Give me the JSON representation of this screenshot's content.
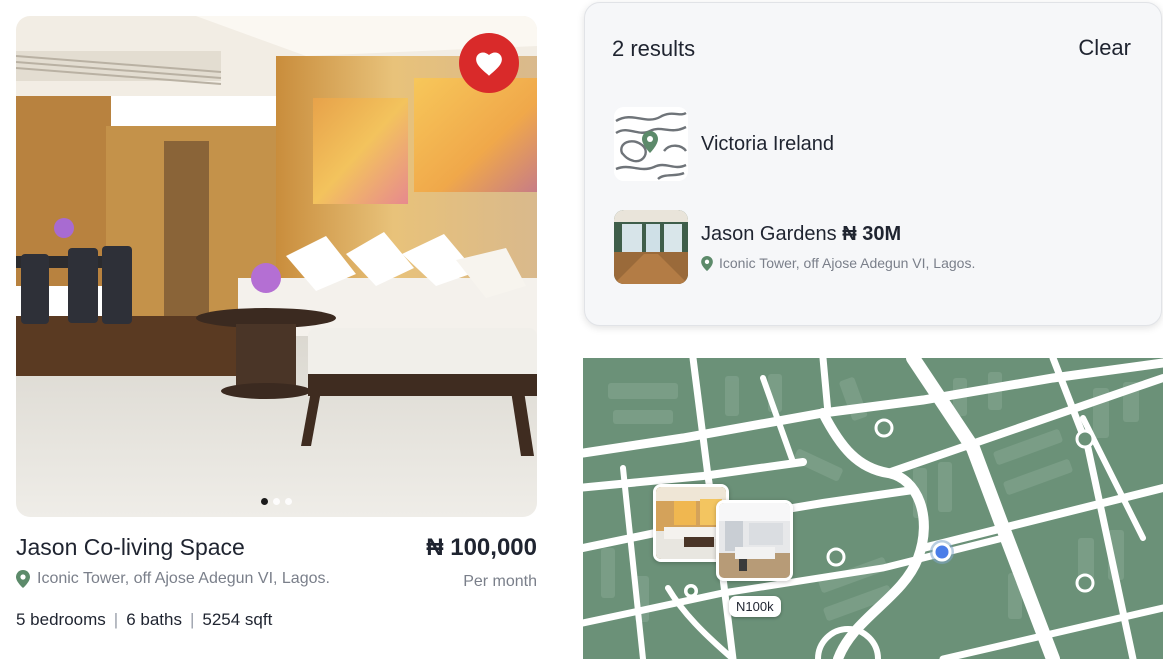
{
  "listing": {
    "title": "Jason Co-living Space",
    "price": "₦ 100,000",
    "period": "Per month",
    "address": "Iconic Tower, off Ajose Adegun VI, Lagos.",
    "bedrooms": "5 bedrooms",
    "baths": "6 baths",
    "area": "5254 sqft",
    "separator": "|",
    "carousel": {
      "slides": 3,
      "active_index": 0
    },
    "favorite_icon": "heart-icon",
    "favorited": true
  },
  "results": {
    "count_label": "2 results",
    "clear_label": "Clear",
    "items": [
      {
        "title": "Victoria Ireland",
        "icon": "map-pin-icon"
      },
      {
        "title": "Jason Gardens",
        "price": "₦ 30M",
        "address": "Iconic Tower, off Ajose Adegun VI, Lagos.",
        "icon": "location-pin-icon"
      }
    ]
  },
  "map": {
    "price_tag": "N100k"
  },
  "colors": {
    "favorite": "#d92a2a",
    "map_fill": "#6b9178",
    "pin_green": "#5c8a6a",
    "selected_marker": "#4a7de8",
    "text_primary": "#1f2430",
    "text_secondary": "#7a7f8a"
  }
}
